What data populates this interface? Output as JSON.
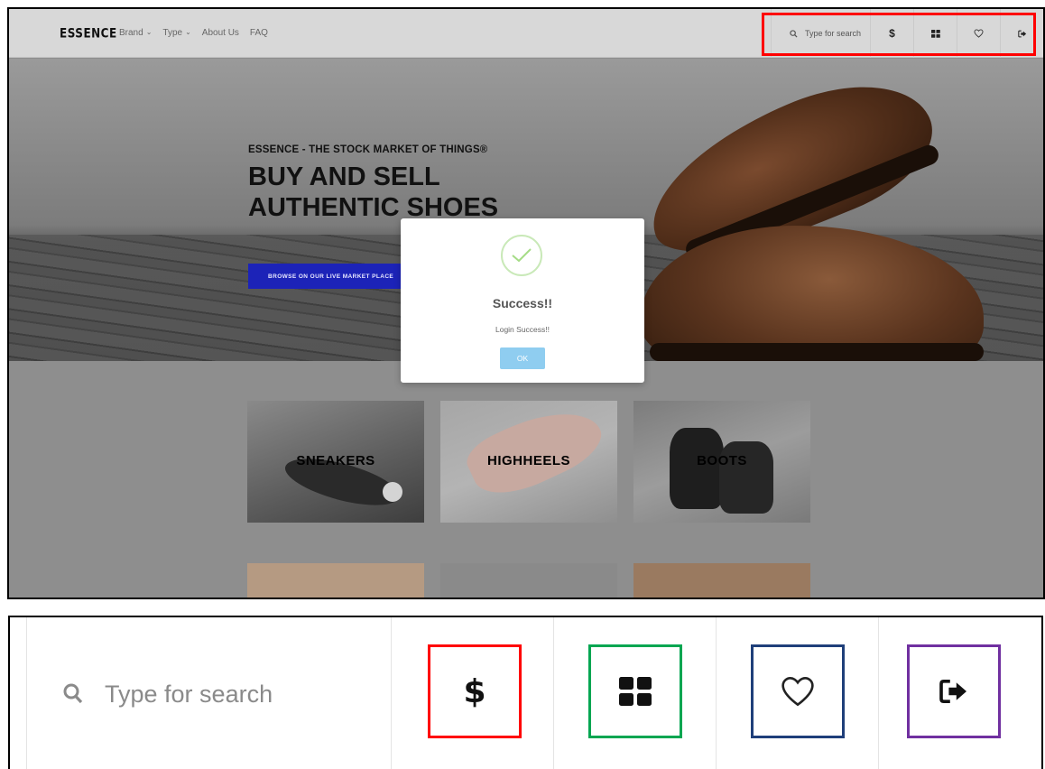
{
  "navbar": {
    "logo": "ESSENCE",
    "links": [
      {
        "label": "Brand",
        "has_caret": true
      },
      {
        "label": "Type",
        "has_caret": true
      },
      {
        "label": "About Us",
        "has_caret": false
      },
      {
        "label": "FAQ",
        "has_caret": false
      }
    ],
    "search_placeholder": "Type for search",
    "icons": [
      "search-icon",
      "dollar-icon",
      "grid-icon",
      "heart-icon",
      "sign-out-icon"
    ],
    "dollar_glyph": "$",
    "highlight_color": "#ff0000"
  },
  "hero": {
    "eyebrow": "ESSENCE - THE STOCK MARKET OF THINGS®",
    "title_line1": "BUY AND SELL",
    "title_line2": "AUTHENTIC SHOES",
    "cta_label": "BROWSE ON OUR LIVE MARKET PLACE",
    "cta_color": "#1c23b8"
  },
  "categories": [
    {
      "label": "SNEAKERS"
    },
    {
      "label": "HIGHHEELS"
    },
    {
      "label": "BOOTS"
    }
  ],
  "dialog": {
    "title": "Success!!",
    "message": "Login Success!!",
    "ok_label": "OK",
    "icon": "check-icon",
    "ok_color": "#8fcdf0"
  },
  "zoom": {
    "search_placeholder": "Type for search",
    "dollar_glyph": "$",
    "box_colors": {
      "dollar": "#ff0000",
      "grid": "#00a651",
      "heart": "#1f3f7a",
      "signout": "#7030a0"
    }
  }
}
